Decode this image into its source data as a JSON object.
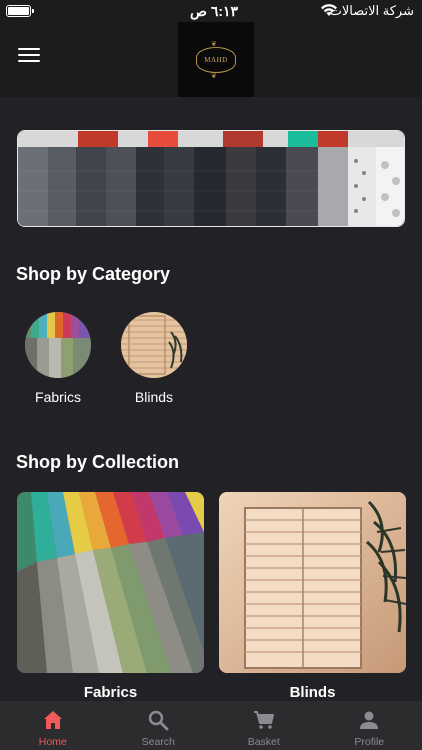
{
  "status_bar": {
    "time": "٦:١٣ ص",
    "carrier": "شركة الاتصالات",
    "icons": [
      "battery-icon",
      "wifi-icon"
    ]
  },
  "header": {
    "menu_icon": "hamburger-menu-icon",
    "logo_text": "MAHD"
  },
  "banner": {
    "image": "fabric-swatches-banner"
  },
  "categories": {
    "title": "Shop by Category",
    "items": [
      {
        "label": "Fabrics",
        "image": "fabric-swatches"
      },
      {
        "label": "Blinds",
        "image": "window-blinds"
      }
    ]
  },
  "collections": {
    "title": "Shop by Collection",
    "items": [
      {
        "label": "Fabrics",
        "image": "fabric-swatches"
      },
      {
        "label": "Blinds",
        "image": "window-blinds"
      }
    ]
  },
  "bottom_nav": {
    "active_color": "#ef5b5b",
    "inactive_color": "#8c8c90",
    "items": [
      {
        "label": "Home",
        "icon": "home-icon",
        "active": true
      },
      {
        "label": "Search",
        "icon": "search-icon",
        "active": false
      },
      {
        "label": "Basket",
        "icon": "cart-icon",
        "active": false
      },
      {
        "label": "Profile",
        "icon": "person-icon",
        "active": false
      }
    ]
  }
}
